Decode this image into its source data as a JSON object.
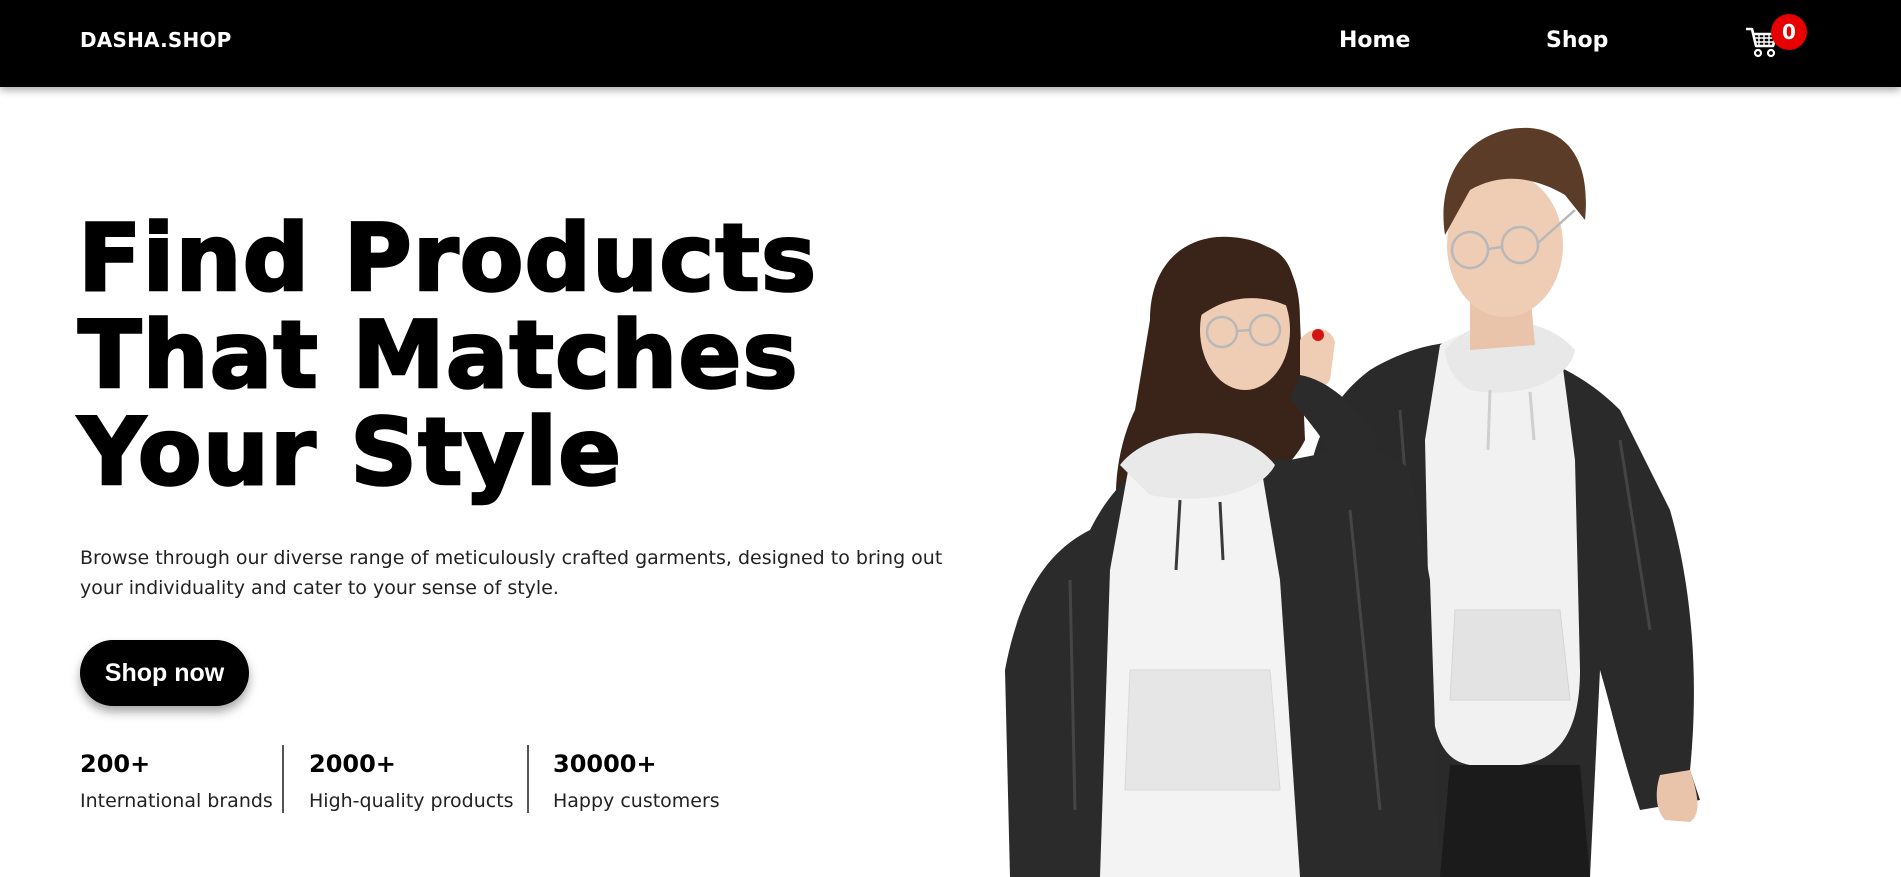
{
  "header": {
    "logo": "DASHA.SHOP",
    "nav": [
      {
        "label": "Home"
      },
      {
        "label": "Shop"
      }
    ],
    "cart": {
      "icon": "cart-icon",
      "count": "0",
      "badge_color": "#e60000"
    }
  },
  "hero": {
    "title_lines": [
      "Find Products",
      "That Matches",
      "Your Style"
    ],
    "description": "Browse through our diverse range of meticulously crafted garments, designed to bring out your individuality and cater to your sense of style.",
    "cta_label": "Shop now",
    "image_alt": "couple-in-hoodies-image"
  },
  "stats": [
    {
      "value": "200+",
      "label": "International brands"
    },
    {
      "value": "2000+",
      "label": "High-quality products"
    },
    {
      "value": "30000+",
      "label": "Happy customers"
    }
  ],
  "colors": {
    "accent": "#000000",
    "background": "#ffffff",
    "badge": "#e60000"
  }
}
